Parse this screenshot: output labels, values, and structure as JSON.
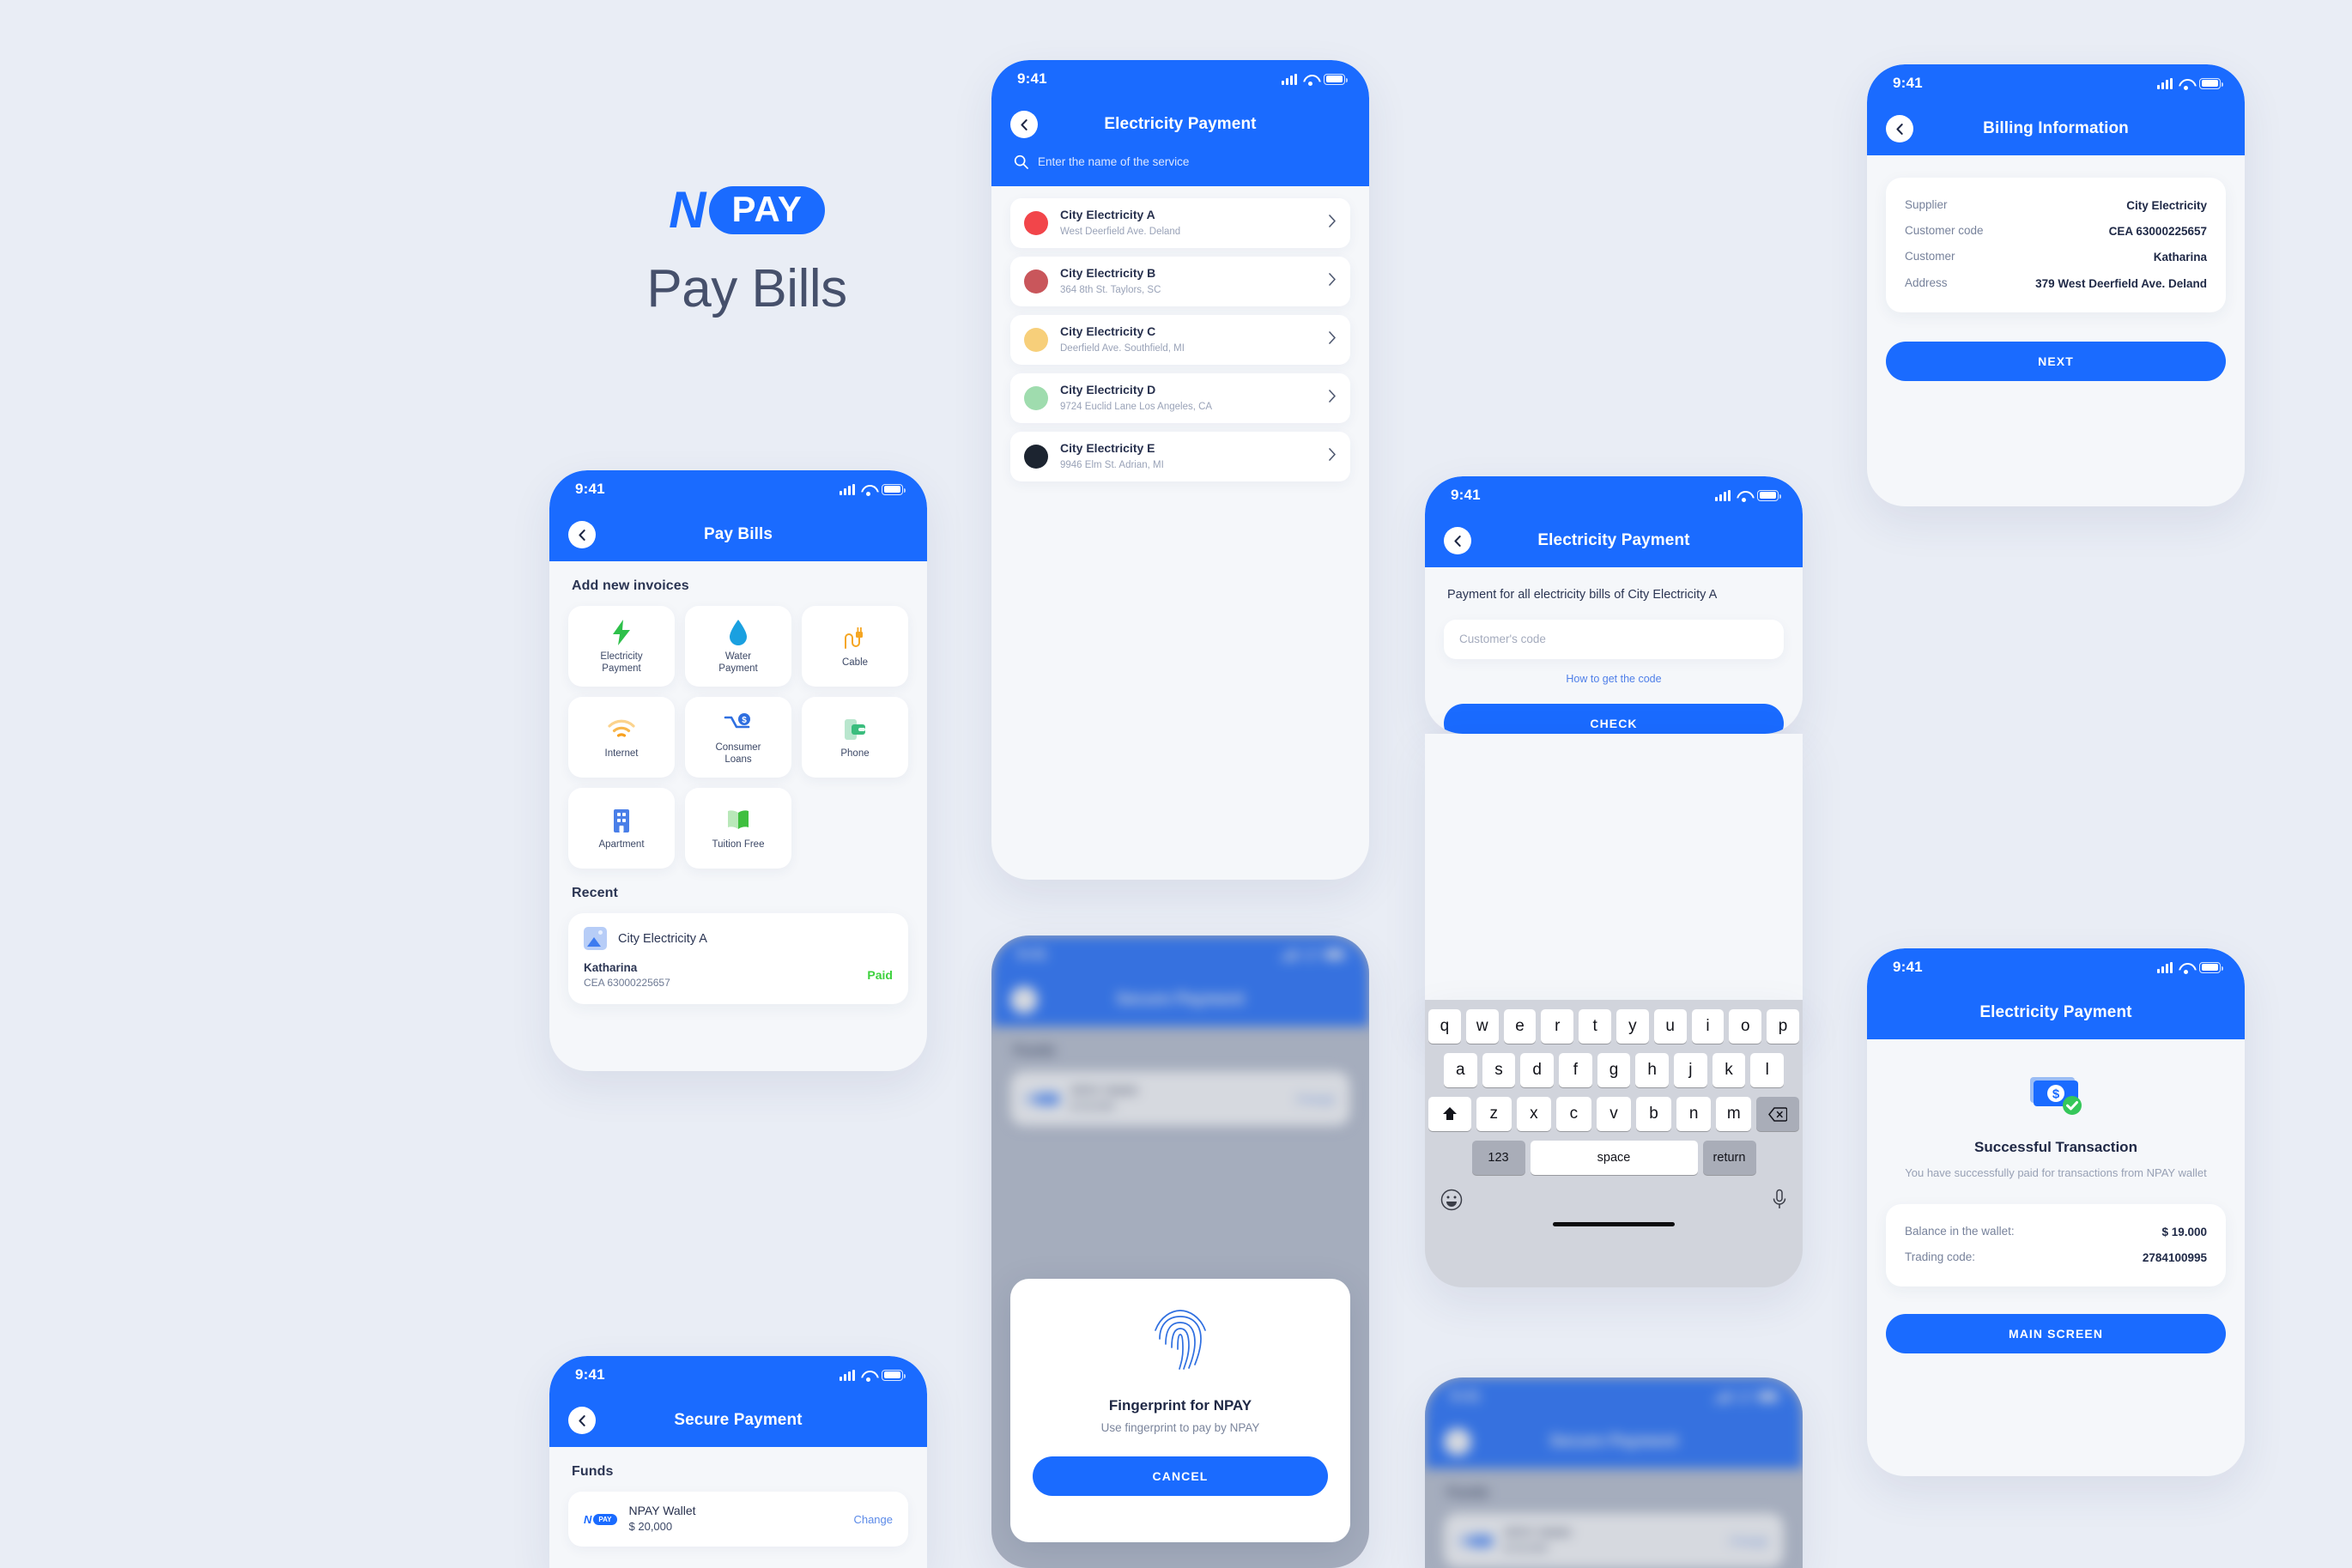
{
  "hero": {
    "logo_n": "N",
    "logo_pay": "PAY",
    "title": "Pay Bills"
  },
  "status": {
    "time": "9:41"
  },
  "screens": {
    "pay_bills": {
      "title": "Pay Bills",
      "section_invoices": "Add new invoices",
      "tiles": [
        {
          "label": "Electricity\nPayment",
          "icon": "bolt-icon",
          "color": "#2ec04a"
        },
        {
          "label": "Water\nPayment",
          "icon": "water-drop-icon",
          "color": "#1aa0e0"
        },
        {
          "label": "Cable",
          "icon": "cable-plug-icon",
          "color": "#f5a623"
        },
        {
          "label": "Internet",
          "icon": "wifi-icon",
          "color": "#f7b733"
        },
        {
          "label": "Consumer\nLoans",
          "icon": "loan-icon",
          "color": "#2f6fe0"
        },
        {
          "label": "Phone",
          "icon": "phone-wallet-icon",
          "color": "#3bbd7e"
        },
        {
          "label": "Apartment",
          "icon": "building-icon",
          "color": "#4a7fe8"
        },
        {
          "label": "Tuition Free",
          "icon": "book-icon",
          "color": "#3fbf3f"
        }
      ],
      "section_recent": "Recent",
      "recent": {
        "service": "City Electricity A",
        "person": "Katharina",
        "code": "CEA 63000225657",
        "status": "Paid",
        "status_color": "#3dd13d"
      }
    },
    "electricity_list": {
      "title": "Electricity Payment",
      "search_placeholder": "Enter the name of the service",
      "items": [
        {
          "name": "City Electricity A",
          "address": "West Deerfield Ave. Deland",
          "avatar_color": "#f2454a"
        },
        {
          "name": "City Electricity B",
          "address": "364 8th St. Taylors, SC",
          "avatar_color": "#c9565b"
        },
        {
          "name": "City Electricity C",
          "address": "Deerfield Ave. Southfield, MI",
          "avatar_color": "#f7cf7a"
        },
        {
          "name": "City Electricity D",
          "address": "9724 Euclid Lane Los Angeles, CA",
          "avatar_color": "#9fdcae"
        },
        {
          "name": "City Electricity E",
          "address": "9946 Elm St. Adrian, MI",
          "avatar_color": "#1c2430"
        }
      ]
    },
    "billing_info": {
      "title": "Billing Information",
      "rows": [
        {
          "key": "Supplier",
          "value": "City Electricity"
        },
        {
          "key": "Customer code",
          "value": "CEA 63000225657"
        },
        {
          "key": "Customer",
          "value": "Katharina"
        },
        {
          "key": "Address",
          "value": "379 West Deerfield Ave. Deland"
        }
      ],
      "next_label": "NEXT"
    },
    "code_entry": {
      "title": "Electricity Payment",
      "paragraph": "Payment for all electricity bills of City Electricity A",
      "input_placeholder": "Customer's code",
      "input_value": "",
      "help_link": "How to get the code",
      "check_label": "CHECK",
      "keyboard": {
        "row1": [
          "q",
          "w",
          "e",
          "r",
          "t",
          "y",
          "u",
          "i",
          "o",
          "p"
        ],
        "row2": [
          "a",
          "s",
          "d",
          "f",
          "g",
          "h",
          "j",
          "k",
          "l"
        ],
        "row3": [
          "z",
          "x",
          "c",
          "v",
          "b",
          "n",
          "m"
        ],
        "shift": "shift-icon",
        "backspace": "backspace-icon",
        "numbers": "123",
        "space": "space",
        "return": "return",
        "emoji": "emoji-icon",
        "mic": "microphone-icon"
      }
    },
    "secure_payment": {
      "title": "Secure Payment",
      "section_funds": "Funds",
      "wallet_name": "NPAY Wallet",
      "wallet_amount": "$ 20,000",
      "change_label": "Change",
      "logo_n": "N",
      "logo_pay": "PAY"
    },
    "fingerprint": {
      "title": "Fingerprint for NPAY",
      "subtitle": "Use fingerprint to pay by NPAY",
      "cancel_label": "CANCEL",
      "icon": "fingerprint-icon"
    },
    "success": {
      "title": "Electricity Payment",
      "icon": "money-check-icon",
      "headline": "Successful Transaction",
      "message": "You have successfully paid for transactions from NPAY wallet",
      "rows": [
        {
          "key": "Balance in the wallet:",
          "value": "$ 19.000"
        },
        {
          "key": "Trading code:",
          "value": "2784100995"
        }
      ],
      "main_label": "MAIN SCREEN"
    }
  },
  "colors": {
    "brand": "#1a6bff",
    "bg": "#e9edf5",
    "screen": "#f5f7fa",
    "success": "#3dd13d"
  }
}
